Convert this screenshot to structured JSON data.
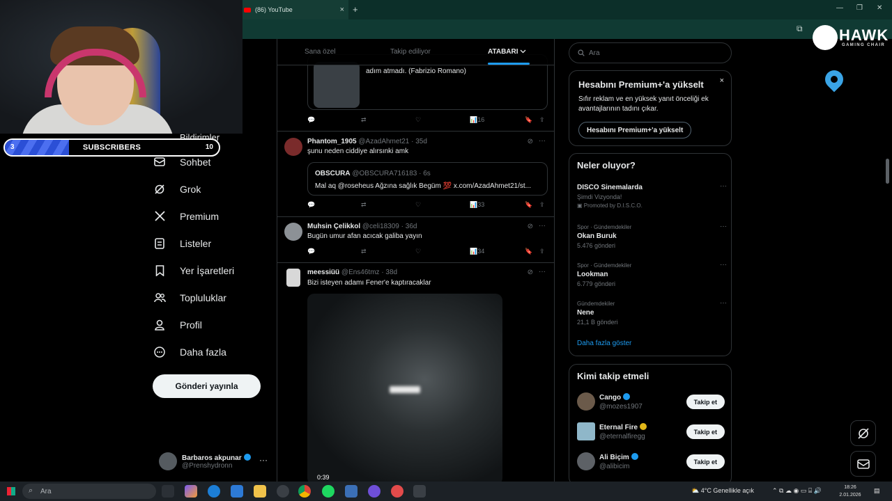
{
  "browser": {
    "tab_title": "(86) YouTube",
    "tab_close": "×",
    "new_tab": "+"
  },
  "stream_overlay": {
    "subscribers_label": "SUBSCRIBERS",
    "subscribers_current": "3",
    "subscribers_goal": "10",
    "subscribers_progress": 0.3,
    "brand_name": "HAWK",
    "brand_tagline": "GAMING CHAIR"
  },
  "nav": {
    "partial_item": "Bildirimler",
    "items": [
      {
        "label": "Sohbet",
        "icon": "mail-icon"
      },
      {
        "label": "Grok",
        "icon": "grok-icon"
      },
      {
        "label": "Premium",
        "icon": "x-logo-icon"
      },
      {
        "label": "Listeler",
        "icon": "list-icon"
      },
      {
        "label": "Yer İşaretleri",
        "icon": "bookmark-icon"
      },
      {
        "label": "Topluluklar",
        "icon": "communities-icon"
      },
      {
        "label": "Profil",
        "icon": "person-icon"
      },
      {
        "label": "Daha fazla",
        "icon": "more-circle-icon"
      }
    ],
    "post_button": "Gönderi yayınla",
    "account": {
      "name": "Barbaros akpunar",
      "handle": "@Prenshydronn",
      "more": "···"
    }
  },
  "timeline": {
    "tabs": [
      "Sana özel",
      "Takip ediliyor",
      "ATABARI"
    ],
    "tweets": [
      {
        "text": "adım atmadı. (Fabrizio Romano)",
        "views": "16"
      },
      {
        "name": "Phantom_1905",
        "handle": "@AzadAhmet21 · 35d",
        "text": "şunu neden ciddiye alırsınki amk",
        "quote": {
          "name": "OBSCURA",
          "handle": "@OBSCURA716183 · 6s",
          "text": "Mal aq @roseheus Ağzına sağlık Begüm 💯 x.com/AzadAhmet21/st..."
        },
        "views": "33"
      },
      {
        "name": "Muhsin Çelikkol",
        "handle": "@celi18309 · 36d",
        "text": "Bugün umur afan acıcak galiba yayın",
        "views": "34"
      },
      {
        "name": "meessiüü",
        "handle": "@Ens46tmz · 38d",
        "text": "Bizi isteyen adamı Fener'e kaptıracaklar",
        "video_duration": "0:39"
      }
    ]
  },
  "sidebar": {
    "search_placeholder": "Ara",
    "premium": {
      "title": "Hesabını Premium+'a yükselt",
      "body": "Sıfır reklam ve en yüksek yanıt önceliği ek avantajlarının tadını çıkar.",
      "button": "Hesabını Premium+'a yükselt",
      "close": "×"
    },
    "trends": {
      "title": "Neler oluyor?",
      "items": [
        {
          "meta": "",
          "topic": "DISCO Sinemalarda",
          "sub": "Şimdi Vizyonda!",
          "promo": "Promoted by D.I.S.C.O."
        },
        {
          "meta": "Spor · Gündemdekiler",
          "topic": "Okan Buruk",
          "sub": "5.476 gönderi"
        },
        {
          "meta": "Spor · Gündemdekiler",
          "topic": "Lookman",
          "sub": "6.779 gönderi"
        },
        {
          "meta": "Gündemdekiler",
          "topic": "Nene",
          "sub": "21,1 B gönderi"
        }
      ],
      "show_more": "Daha fazla göster"
    },
    "who_to_follow": {
      "title": "Kimi takip etmeli",
      "follow_label": "Takip et",
      "accounts": [
        {
          "name": "Cango",
          "handle": "@mozes1907",
          "badge_color": "#1d9bf0"
        },
        {
          "name": "Eternal Fire",
          "handle": "@eternalfiregg",
          "badge_color": "#e2b719"
        },
        {
          "name": "Ali Biçim",
          "handle": "@alibicim",
          "badge_color": "#1d9bf0"
        }
      ]
    }
  },
  "taskbar": {
    "search_placeholder": "Ara",
    "weather": "4°C Genellikle açık",
    "time": "18:26",
    "date": "2.01.2026"
  },
  "colors": {
    "accent": "#1d9bf0",
    "background": "#000000",
    "border": "#2f3336",
    "browser_chrome": "#0c2f29"
  }
}
